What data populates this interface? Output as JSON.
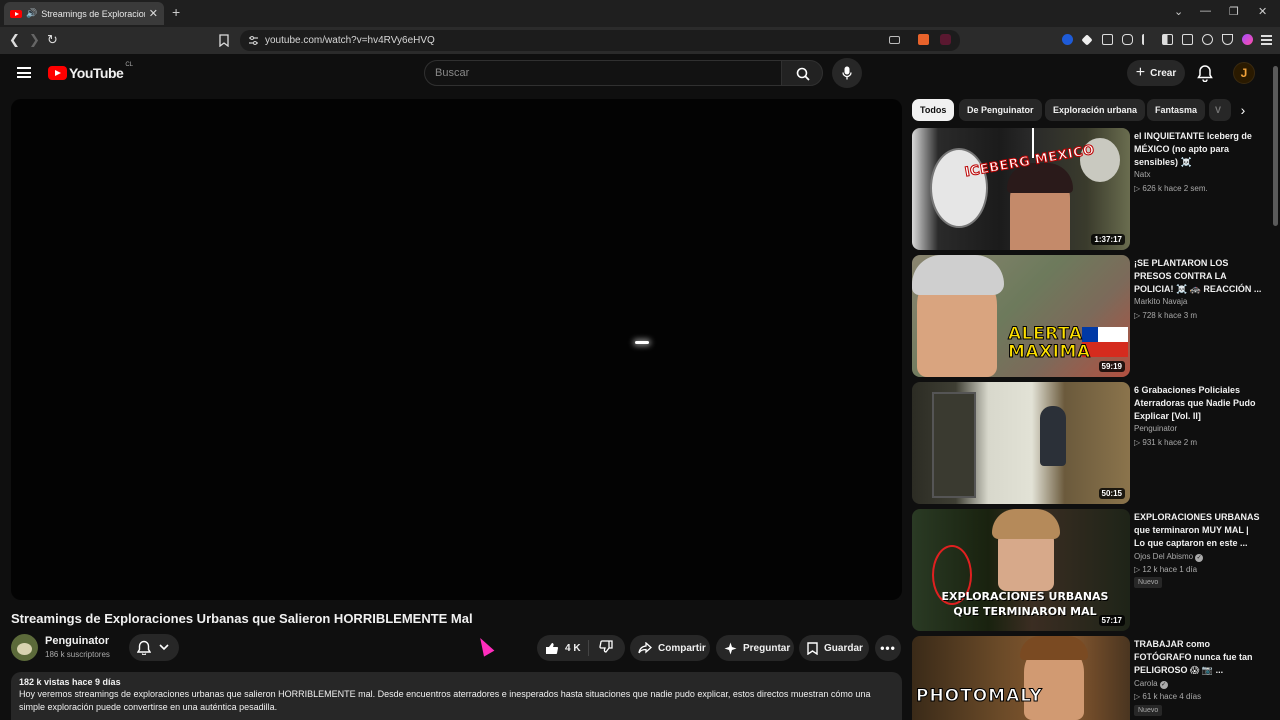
{
  "browser": {
    "tab_title": "Streamings de Exploraciones Urbanas",
    "url": "youtube.com/watch?v=hv4RVy6eHVQ"
  },
  "header": {
    "logo_text": "YouTube",
    "country": "CL",
    "search_placeholder": "Buscar",
    "create_label": "Crear",
    "avatar_letter": "J"
  },
  "video": {
    "title": "Streamings de Exploraciones Urbanas que Salieron HORRIBLEMENTE Mal",
    "channel": "Penguinator",
    "subscribers": "186 k suscriptores",
    "likes": "4 K",
    "share_label": "Compartir",
    "ask_label": "Preguntar",
    "save_label": "Guardar",
    "views_date": "182 k vistas  hace 9 días",
    "description": "Hoy veremos streamings de exploraciones urbanas que salieron HORRIBLEMENTE mal. Desde encuentros aterradores e inesperados hasta situaciones que nadie pudo explicar, estos directos muestran cómo una simple exploración puede convertirse en una auténtica pesadilla."
  },
  "chips": [
    "Todos",
    "De Penguinator",
    "Exploración urbana",
    "Fantasma",
    "V"
  ],
  "recommendations": [
    {
      "title": "el INQUIETANTE Iceberg de MÉXICO (no apto para sensibles) ☠️",
      "channel": "Natx",
      "meta": "▷ 626 k  hace 2 sem.",
      "duration": "1:37:17",
      "overlay": "ICEBERG MEXICO"
    },
    {
      "title": "¡SE PLANTARON LOS PRESOS CONTRA LA POLICIA! ☠️ 🚓 REACCIÓN ...",
      "channel": "Markito Navaja",
      "meta": "▷ 728 k  hace 3 m",
      "duration": "59:19",
      "overlay": "ALERTA MAXIMA"
    },
    {
      "title": "6 Grabaciones Policiales Aterradoras que Nadie Pudo Explicar [Vol. II]",
      "channel": "Penguinator",
      "meta": "▷ 931 k  hace 2 m",
      "duration": "50:15",
      "overlay": ""
    },
    {
      "title": "EXPLORACIONES URBANAS que terminaron MUY MAL | Lo que captaron en este ...",
      "channel": "Ojos Del Abismo",
      "meta": "▷ 12 k  hace 1 día",
      "duration": "57:17",
      "badge": "Nuevo",
      "overlay": "EXPLORACIONES URBANAS QUE TERMINARON MAL"
    },
    {
      "title": "TRABAJAR como FOTÓGRAFO nunca fue tan PELIGROSO 😱 📷 ...",
      "channel": "Carola",
      "meta": "▷ 61 k  hace 4 días",
      "duration": "",
      "badge": "Nuevo",
      "overlay": "PHOTOMALY"
    }
  ]
}
